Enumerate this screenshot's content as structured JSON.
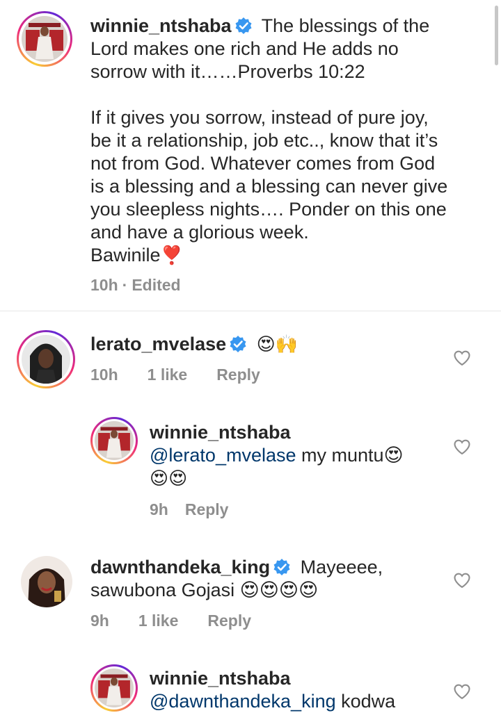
{
  "post": {
    "username": "winnie_ntshaba",
    "caption_line1": "The blessings of the",
    "caption_line2": "Lord makes one rich and He adds no",
    "caption_line3": "sorrow with it……Proverbs 10:22",
    "caption_para2": [
      "If it gives you sorrow, instead of pure joy,",
      "be it a relationship, job etc.., know that it’s",
      "not from God. Whatever comes from God",
      "is a blessing and a blessing can never give",
      "you sleepless nights…. Ponder on this one",
      "and have a glorious week."
    ],
    "caption_sign": "Bawinile",
    "sign_emoji": "❣️",
    "time": "10h",
    "edited": "Edited",
    "meta_sep": "·"
  },
  "comments": [
    {
      "username": "lerato_mvelase",
      "text": "😍🙌",
      "time": "10h",
      "likes": "1 like",
      "reply": "Reply"
    },
    {
      "username": "winnie_ntshaba",
      "mention": "@lerato_mvelase",
      "text_line1": " my muntu😍",
      "text_line2": "😍😍",
      "time": "9h",
      "reply": "Reply"
    },
    {
      "username": "dawnthandeka_king",
      "text_line1": "Mayeeee,",
      "text_line2": "sawubona Gojasi 😍😍😍😍",
      "time": "9h",
      "likes": "1 like",
      "reply": "Reply"
    },
    {
      "username": "winnie_ntshaba",
      "mention": "@dawnthandeka_king",
      "text_line1": " kodwa"
    }
  ],
  "colors": {
    "verified": "#3897f0",
    "meta": "#8e8e8e",
    "mention": "#00376b",
    "text": "#262626"
  }
}
